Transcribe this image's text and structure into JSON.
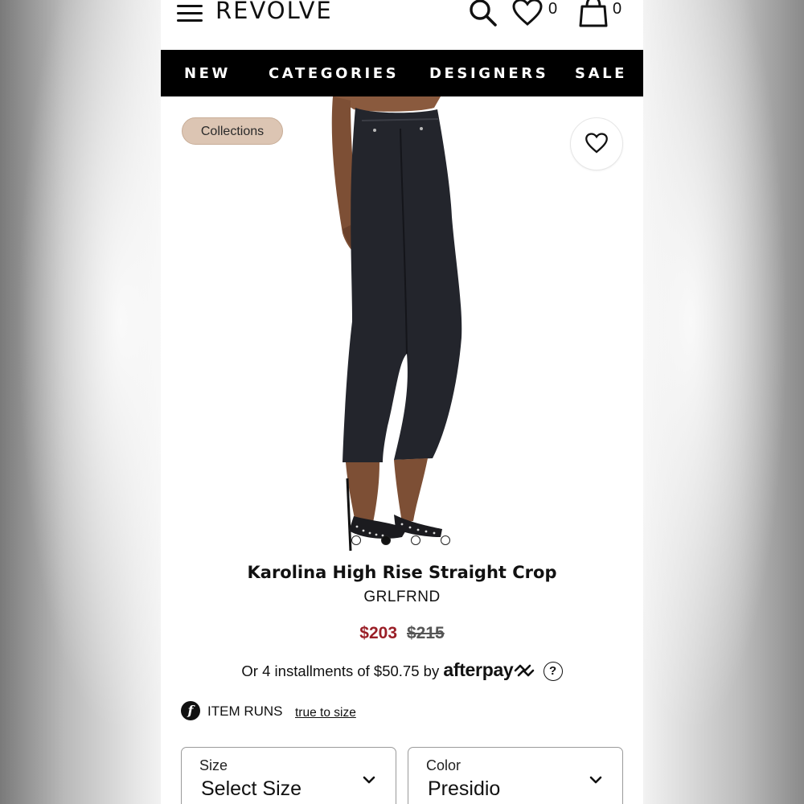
{
  "header": {
    "logo": "REVOLVE",
    "wishlist_count": "0",
    "cart_count": "0"
  },
  "nav": {
    "items": [
      "NEW",
      "CATEGORIES",
      "DESIGNERS",
      "SALE"
    ]
  },
  "hero": {
    "badge": "Collections",
    "image_count": 4,
    "active_image": 2
  },
  "product": {
    "title": "Karolina High Rise Straight Crop",
    "brand": "GRLFRND",
    "price_sale": "$203",
    "price_original": "$215",
    "installments_text": "Or 4 installments of $50.75 by",
    "afterpay_brand": "afterpay",
    "help_glyph": "?",
    "fit_icon_glyph": "f",
    "fit_label": "ITEM RUNS",
    "fit_value": "true to size"
  },
  "selectors": {
    "size_label": "Size",
    "size_value": "Select Size",
    "color_label": "Color",
    "color_value": "Presidio"
  },
  "colors": {
    "sale_price": "#9a1f27",
    "nav_bg": "#000000",
    "badge_bg": "#dcc5b3"
  },
  "icons": [
    "menu-icon",
    "search-icon",
    "heart-icon",
    "bag-icon",
    "afterpay-loop-icon",
    "help-icon",
    "fit-f-icon",
    "chevron-down-icon"
  ]
}
